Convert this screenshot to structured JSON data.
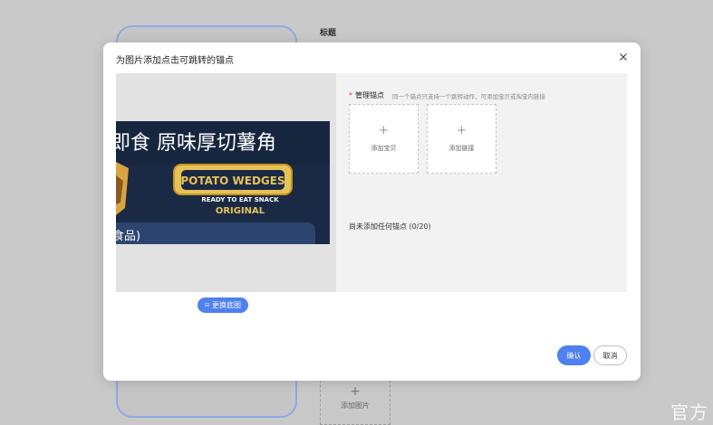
{
  "background": {
    "title": "标题",
    "add_image_label": "添加图片",
    "watermark": "官方"
  },
  "dialog": {
    "title": "为图片添加点击可跳转的锚点",
    "anchor_label": "管理锚点",
    "anchor_hint": "同一个锚点只支持一个跳转动作，可添加宝贝或淘宝内链接",
    "add_item_label": "添加宝贝",
    "add_link_label": "添加链接",
    "anchor_status": "尚未添加任何锚点 (0/20)",
    "replace_image_label": "更换底图",
    "confirm_label": "确认",
    "cancel_label": "取消"
  },
  "product_image": {
    "cn_title": "即食 原味厚切薯角",
    "brand": "POTATO WEDGES",
    "tagline": "READY TO EAT SNACK",
    "flavor": "ORIGINAL",
    "bottom_fragment": "食品)"
  },
  "colors": {
    "accent": "#4e80ef",
    "required": "#e2393a"
  }
}
